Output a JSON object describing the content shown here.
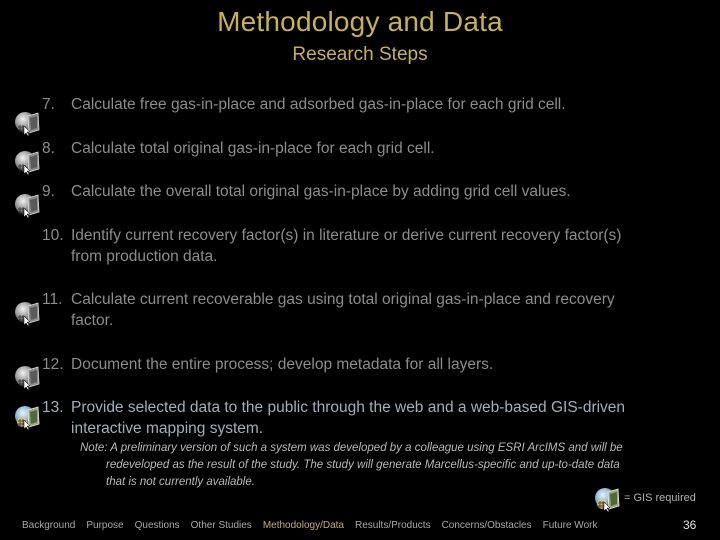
{
  "header": {
    "title": "Methodology and Data",
    "subtitle": "Research Steps"
  },
  "steps": [
    {
      "num": "7.",
      "text": "Calculate free gas-in-place and adsorbed gas-in-place for each grid cell.",
      "gis": true
    },
    {
      "num": "8.",
      "text": "Calculate total original gas-in-place for each grid cell.",
      "gis": true
    },
    {
      "num": "9.",
      "text": "Calculate the overall total original gas-in-place by adding grid cell values.",
      "gis": true
    },
    {
      "num": "10.",
      "text_line1": "Identify current recovery factor(s) in literature or derive current recovery factor(s)",
      "text_line2": "from production data.",
      "gis": false
    },
    {
      "num": "11.",
      "text_line1": "Calculate current recoverable gas using total original gas-in-place and recovery",
      "text_line2": "factor.",
      "gis": true
    },
    {
      "num": "12.",
      "text": "Document the entire process; develop metadata for all layers.",
      "gis": true
    },
    {
      "num": "13.",
      "text_line1": "Provide selected data to the public through the web and a web-based GIS-driven",
      "text_line2": "interactive mapping system.",
      "gis": true,
      "highlighted": true
    }
  ],
  "note": {
    "line1": "Note:  A preliminary version of such a system was developed by a colleague  using ESRI ArcIMS and will be",
    "line2": "redeveloped as the result of the study.  The study will generate Marcellus-specific and up-to-date data",
    "line3": "that is not currently available."
  },
  "legend": {
    "icon": "gis-globe-map-icon",
    "label": "= GIS required"
  },
  "nav": {
    "items": [
      {
        "label": "Background",
        "active": false
      },
      {
        "label": "Purpose",
        "active": false
      },
      {
        "label": "Questions",
        "active": false
      },
      {
        "label": "Other Studies",
        "active": false
      },
      {
        "label": "Methodology/Data",
        "active": true
      },
      {
        "label": "Results/Products",
        "active": false
      },
      {
        "label": "Concerns/Obstacles",
        "active": false
      },
      {
        "label": "Future Work",
        "active": false
      }
    ]
  },
  "page_number": "36",
  "colors": {
    "title": "#c8b24a",
    "body_text": "#8c8c8c",
    "highlight_text": "#9fb0b8",
    "nav_active": "#c4ad6c",
    "background": "#000000"
  }
}
